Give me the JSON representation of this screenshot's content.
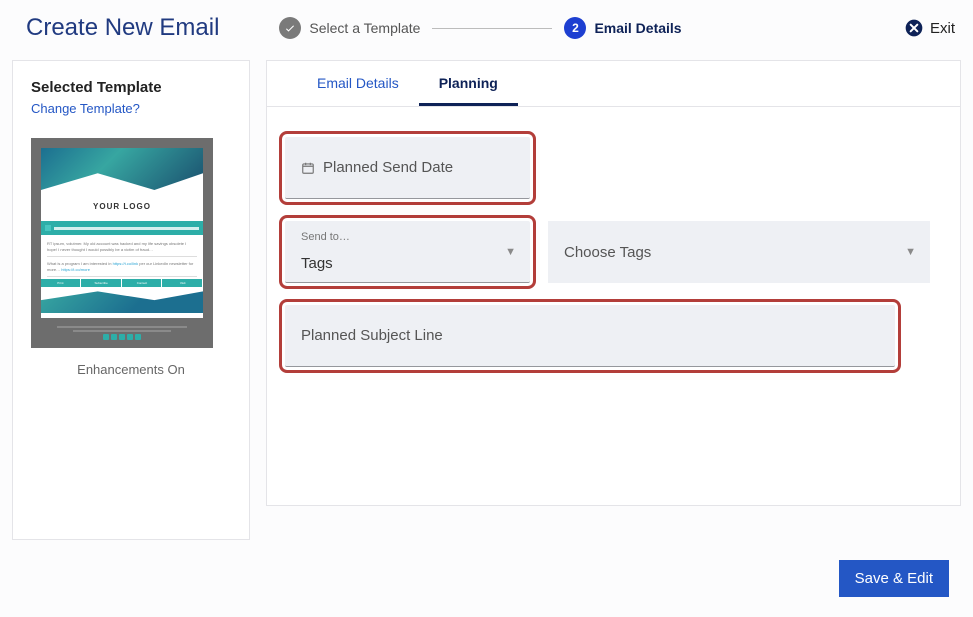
{
  "header": {
    "title": "Create New Email",
    "steps": [
      {
        "label": "Select a Template",
        "badge_icon": "check"
      },
      {
        "label": "Email Details",
        "badge_text": "2"
      }
    ],
    "exit_label": "Exit"
  },
  "sidebar": {
    "heading": "Selected Template",
    "change_link": "Change Template?",
    "thumb_logo_text": "YOUR LOGO",
    "caption": "Enhancements On"
  },
  "tabs": {
    "email_details": "Email Details",
    "planning": "Planning",
    "active": "planning"
  },
  "form": {
    "planned_send_date": {
      "placeholder": "Planned Send Date"
    },
    "send_to": {
      "label": "Send to…",
      "value": "Tags"
    },
    "choose_tags": {
      "placeholder": "Choose Tags"
    },
    "subject": {
      "placeholder": "Planned Subject Line"
    }
  },
  "footer": {
    "save_label": "Save & Edit"
  }
}
